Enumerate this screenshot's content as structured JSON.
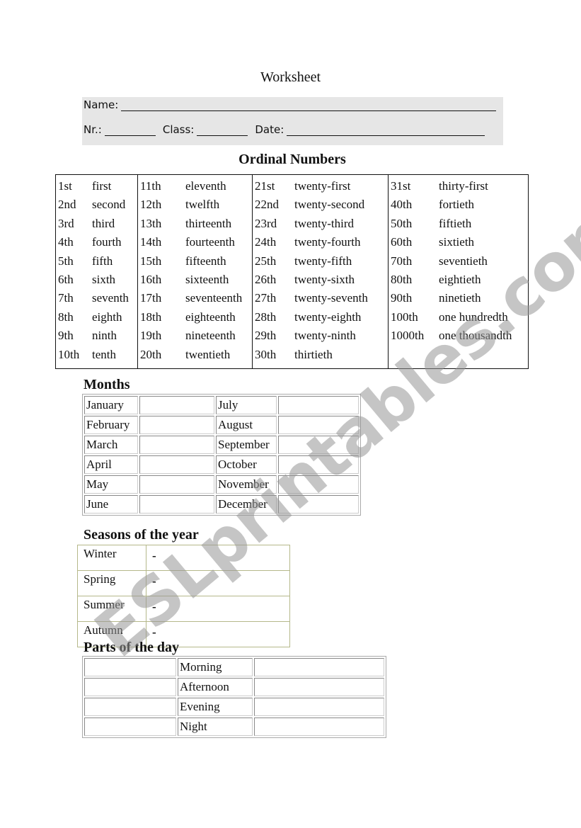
{
  "title": "Worksheet",
  "info": {
    "name_label": "Name:",
    "nr_label": "Nr.:",
    "class_label": "Class:",
    "date_label": "Date:"
  },
  "ordinal": {
    "heading": "Ordinal Numbers",
    "columns": [
      [
        [
          "1st",
          "first"
        ],
        [
          "2nd",
          "second"
        ],
        [
          "3rd",
          "third"
        ],
        [
          "4th",
          "fourth"
        ],
        [
          "5th",
          "fifth"
        ],
        [
          "6th",
          "sixth"
        ],
        [
          "7th",
          "seventh"
        ],
        [
          "8th",
          "eighth"
        ],
        [
          "9th",
          "ninth"
        ],
        [
          "10th",
          "tenth"
        ]
      ],
      [
        [
          "11th",
          "eleventh"
        ],
        [
          "12th",
          "twelfth"
        ],
        [
          "13th",
          "thirteenth"
        ],
        [
          "14th",
          "fourteenth"
        ],
        [
          "15th",
          "fifteenth"
        ],
        [
          "16th",
          "sixteenth"
        ],
        [
          "17th",
          "seventeenth"
        ],
        [
          "18th",
          "eighteenth"
        ],
        [
          "19th",
          "nineteenth"
        ],
        [
          "20th",
          "twentieth"
        ]
      ],
      [
        [
          "21st",
          "twenty-first"
        ],
        [
          "22nd",
          "twenty-second"
        ],
        [
          "23rd",
          "twenty-third"
        ],
        [
          "24th",
          "twenty-fourth"
        ],
        [
          "25th",
          "twenty-fifth"
        ],
        [
          "26th",
          "twenty-sixth"
        ],
        [
          "27th",
          "twenty-seventh"
        ],
        [
          "28th",
          "twenty-eighth"
        ],
        [
          "29th",
          "twenty-ninth"
        ],
        [
          "30th",
          "thirtieth"
        ]
      ],
      [
        [
          "31st",
          "thirty-first"
        ],
        [
          "40th",
          "fortieth"
        ],
        [
          "50th",
          "fiftieth"
        ],
        [
          "60th",
          "sixtieth"
        ],
        [
          "70th",
          "seventieth"
        ],
        [
          "80th",
          "eightieth"
        ],
        [
          "90th",
          "ninetieth"
        ],
        [
          "100th",
          "one hundredth"
        ],
        [
          "1000th",
          "one thousandth"
        ]
      ]
    ]
  },
  "months": {
    "heading": "Months",
    "rows": [
      [
        "January",
        "",
        "July",
        ""
      ],
      [
        "February",
        "",
        "August",
        ""
      ],
      [
        "March",
        "",
        "September",
        ""
      ],
      [
        "April",
        "",
        "October",
        ""
      ],
      [
        "May",
        "",
        "November",
        ""
      ],
      [
        "June",
        "",
        "December",
        ""
      ]
    ]
  },
  "seasons": {
    "heading": "Seasons of the year",
    "rows": [
      [
        "Winter",
        "-"
      ],
      [
        "Spring",
        "-"
      ],
      [
        "Summer",
        "-"
      ],
      [
        "Autumn",
        "-"
      ]
    ]
  },
  "parts_of_day": {
    "heading": "Parts of the day",
    "rows": [
      [
        "",
        "Morning",
        ""
      ],
      [
        "",
        "Afternoon",
        ""
      ],
      [
        "",
        "Evening",
        ""
      ],
      [
        "",
        "Night",
        ""
      ]
    ]
  },
  "watermark": "ESLprintables.com"
}
